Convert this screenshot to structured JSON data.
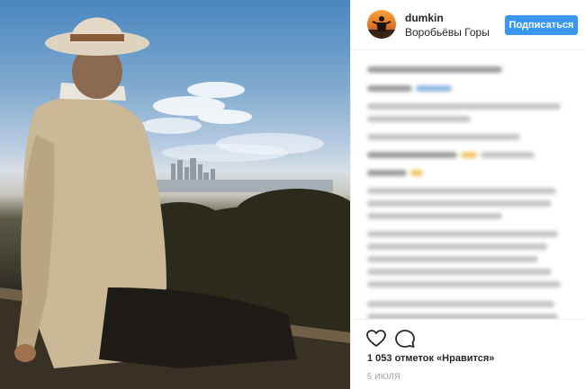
{
  "header": {
    "username": "dumkin",
    "location": "Воробьёвы Горы",
    "follow_label": "Подписаться"
  },
  "photo": {
    "description_icon": "photo-sparrow-hills-city-view"
  },
  "comments": {
    "blurred": true
  },
  "actions": {
    "like_icon": "heart-icon",
    "comment_icon": "comment-icon",
    "likes_text": "1 053 отметок «Нравится»",
    "date_text": "5 ИЮЛЯ"
  },
  "colors": {
    "follow_button": "#3897f0",
    "text": "#262626",
    "muted": "#999999",
    "divider": "#efefef"
  }
}
